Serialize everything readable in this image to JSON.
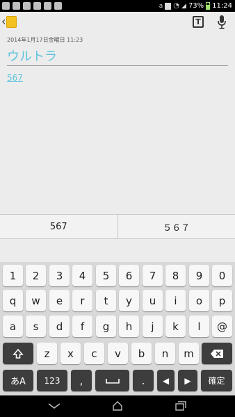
{
  "status_bar": {
    "battery": "73%",
    "time": "11:24"
  },
  "note": {
    "date": "2014年1月17日金曜日 11:23",
    "title": "ウルトラ",
    "body": "567"
  },
  "candidates": [
    "567",
    "５６７"
  ],
  "keyboard": {
    "row_numbers": [
      "1",
      "2",
      "3",
      "4",
      "5",
      "6",
      "7",
      "8",
      "9",
      "0"
    ],
    "row_q": [
      "q",
      "w",
      "e",
      "r",
      "t",
      "y",
      "u",
      "i",
      "o",
      "p"
    ],
    "row_a": [
      "a",
      "s",
      "d",
      "f",
      "g",
      "h",
      "j",
      "k",
      "l",
      "@"
    ],
    "row_z": [
      "z",
      "x",
      "c",
      "v",
      "b",
      "n",
      "m"
    ],
    "mode_label": "あA",
    "num_label": "123",
    "comma": ",",
    "period": ".",
    "enter_label": "確定"
  }
}
